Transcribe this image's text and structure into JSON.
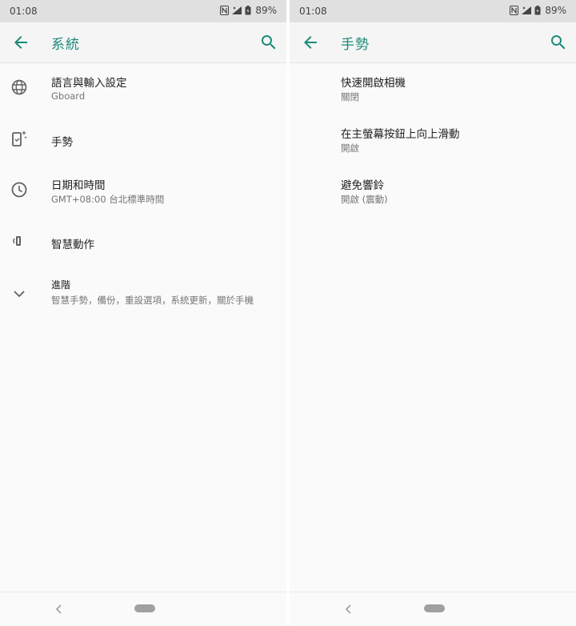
{
  "theme": {
    "accent": "#1a8a78",
    "text_primary": "#212121",
    "text_secondary": "#757575"
  },
  "left": {
    "status": {
      "time": "01:08",
      "battery": "89%"
    },
    "appbar": {
      "title": "系統",
      "back_icon": "arrow-left-icon",
      "search_icon": "search-icon"
    },
    "items": [
      {
        "icon": "globe-icon",
        "title": "語言與輸入設定",
        "summary": "Gboard"
      },
      {
        "icon": "phone-sparkle-icon",
        "title": "手勢",
        "summary": ""
      },
      {
        "icon": "clock-icon",
        "title": "日期和時間",
        "summary": "GMT+08:00 台北標準時間"
      },
      {
        "icon": "smart-action-icon",
        "title": "智慧動作",
        "summary": ""
      },
      {
        "icon": "chevron-down-icon",
        "title": "進階",
        "summary": "智慧手勢，備份，重設選項，系統更新，關於手機"
      }
    ]
  },
  "right": {
    "status": {
      "time": "01:08",
      "battery": "89%"
    },
    "appbar": {
      "title": "手勢",
      "back_icon": "arrow-left-icon",
      "search_icon": "search-icon"
    },
    "items": [
      {
        "title": "快速開啟相機",
        "summary": "關閉"
      },
      {
        "title": "在主螢幕按鈕上向上滑動",
        "summary": "開啟"
      },
      {
        "title": "避免響鈴",
        "summary": "開啟 (震動)"
      }
    ]
  }
}
